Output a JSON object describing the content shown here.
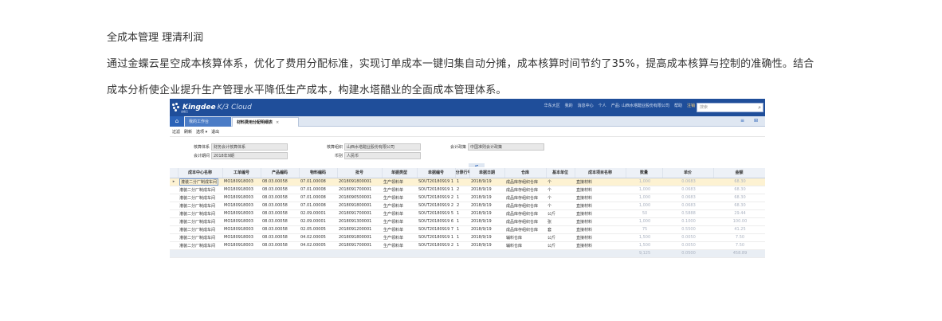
{
  "article": {
    "heading": "全成本管理 理清利润",
    "body": "通过金蝶云星空成本核算体系，优化了费用分配标准，实现订单成本一键归集自动分摊，成本核算时间节约了35%，提高成本核算与控制的准确性。结合成本分析使企业提升生产管理水平降低生产成本，构建水塔醋业的全面成本管理体系。"
  },
  "app": {
    "brand": "Kingdee",
    "product": "K/3 Cloud",
    "brand_sub": "金蝶云",
    "nav_items": [
      "华东大区",
      "我的",
      "消息中心",
      "个人",
      "产品: 山西水塔醋业股份有限公司",
      "帮助",
      "注销"
    ],
    "search_placeholder": "搜索",
    "search_icon": "search-icon",
    "home_icon": "home-icon",
    "tabs": [
      {
        "label": "我的工作台",
        "active": false
      },
      {
        "label": "材料费用分配明细表",
        "active": true
      }
    ],
    "tab_close": "×",
    "tab_tools": "≡ ⊞",
    "toolbar": [
      "过滤",
      "刷新",
      "选项",
      "退出"
    ],
    "toolbar_dropdown": "▾",
    "filters": {
      "account_book_label": "核算体系",
      "account_book_value": "财务会计核算体系",
      "period_label": "会计期间",
      "period_value": "2018年9期",
      "org_label": "核算组织",
      "org_value": "山西水塔醋业股份有限公司",
      "currency_label": "币别",
      "currency_value": "人民币",
      "policy_label": "会计政策",
      "policy_value": "中国准则会计政策"
    },
    "collapse_icon": "chevron-up-icon",
    "grid": {
      "columns": [
        "",
        "成本中心名称",
        "工单编号",
        "产品编码",
        "物料编码",
        "批号",
        "单据类型",
        "单据编号",
        "分录行号",
        "单据日期",
        "仓库",
        "基本单位",
        "成本项目名称",
        "数量",
        "单价",
        "金额"
      ],
      "rows": [
        [
          "▸",
          "灌装二分厂制成车间",
          "MO180918003",
          "08.03.00058",
          "07.01.00008",
          "2018091800001",
          "生产领料单",
          "SOUT20180919 1",
          "1",
          "2018/9/19",
          "成品库存组织仓库",
          "个",
          "直接材料",
          "1,000",
          "0.0683",
          "68.30"
        ],
        [
          "",
          "灌装二分厂制成车间",
          "MO180918003",
          "08.03.00058",
          "07.01.00008",
          "2018091700001",
          "生产领料单",
          "SOUT20180919 1",
          "2",
          "2018/9/19",
          "成品库存组织仓库",
          "个",
          "直接材料",
          "1,000",
          "0.0683",
          "68.30"
        ],
        [
          "",
          "灌装二分厂制成车间",
          "MO180918003",
          "08.03.00058",
          "07.01.00008",
          "2018090500001",
          "生产领料单",
          "SOUT20180919 2",
          "1",
          "2018/9/19",
          "成品库存组织仓库",
          "个",
          "直接材料",
          "1,000",
          "0.0683",
          "68.30"
        ],
        [
          "",
          "灌装二分厂制成车间",
          "MO180918003",
          "08.03.00058",
          "07.01.00008",
          "2018091800001",
          "生产领料单",
          "SOUT20180919 2",
          "2",
          "2018/9/19",
          "成品库存组织仓库",
          "个",
          "直接材料",
          "1,000",
          "0.0683",
          "68.30"
        ],
        [
          "",
          "灌装二分厂制成车间",
          "MO180918003",
          "08.03.00058",
          "02.09.00001",
          "2018091700001",
          "生产领料单",
          "SOUT20180919 5",
          "1",
          "2018/9/19",
          "成品库存组织仓库",
          "公斤",
          "直接材料",
          "50",
          "0.5888",
          "29.44"
        ],
        [
          "",
          "灌装二分厂制成车间",
          "MO180918003",
          "08.03.00058",
          "02.09.00001",
          "2018091300001",
          "生产领料单",
          "SOUT20180919 6",
          "1",
          "2018/9/19",
          "成品库存组织仓库",
          "张",
          "直接材料",
          "1,000",
          "0.1000",
          "100.00"
        ],
        [
          "",
          "灌装二分厂制成车间",
          "MO180918003",
          "08.03.00058",
          "02.05.00005",
          "2018091200001",
          "生产领料单",
          "SOUT20180919 7",
          "1",
          "2018/9/19",
          "成品库存组织仓库",
          "套",
          "直接材料",
          "75",
          "0.5500",
          "41.25"
        ],
        [
          "",
          "灌装二分厂制成车间",
          "MO180918003",
          "08.03.00058",
          "04.02.00005",
          "2018091800001",
          "生产领料单",
          "SOUT20180919 1",
          "1",
          "2018/9/19",
          "辅料仓库",
          "公斤",
          "直接材料",
          "1,500",
          "0.0050",
          "7.50"
        ],
        [
          "",
          "灌装二分厂制成车间",
          "MO180918003",
          "08.03.00058",
          "04.02.00005",
          "2018091700001",
          "生产领料单",
          "SOUT20180919 2",
          "1",
          "2018/9/19",
          "辅料仓库",
          "公斤",
          "直接材料",
          "1,500",
          "0.0050",
          "7.50"
        ]
      ],
      "total": [
        "",
        "",
        "",
        "",
        "",
        "",
        "",
        "",
        "",
        "",
        "",
        "",
        "",
        "9,125",
        "0.0500",
        "458.89"
      ]
    }
  }
}
